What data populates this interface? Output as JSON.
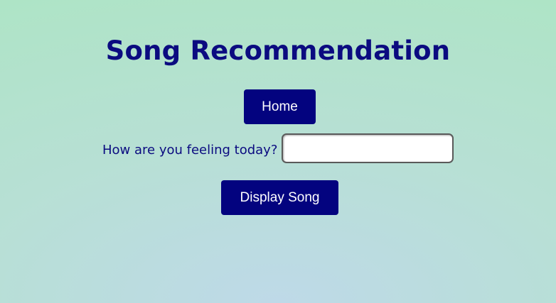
{
  "page": {
    "title": "Song Recommendation"
  },
  "nav": {
    "home_label": "Home"
  },
  "form": {
    "feeling_label": "How are you feeling today?",
    "feeling_value": "",
    "feeling_placeholder": "",
    "submit_label": "Display Song"
  },
  "colors": {
    "accent": "#03037f",
    "title": "#0b0b80",
    "background_top": "#aee4c6",
    "background_bottom": "#bed9e8"
  }
}
